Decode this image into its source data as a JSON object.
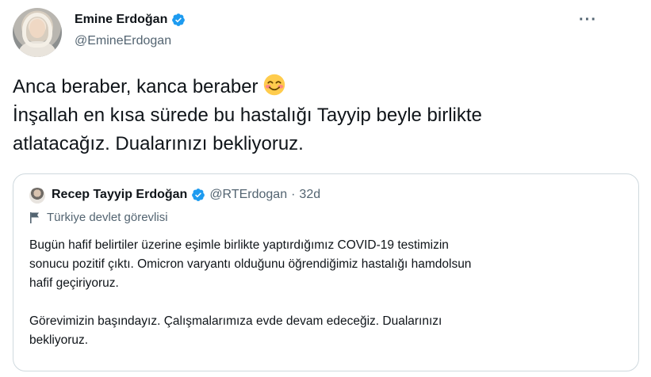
{
  "tweet": {
    "author": {
      "name": "Emine Erdoğan",
      "handle": "@EmineErdogan",
      "verified": true,
      "avatar_icon": "profile-photo"
    },
    "more_icon": "···",
    "text_lines": [
      "Anca beraber, kanca beraber",
      "İnşallah en kısa sürede bu hastalığı Tayyip beyle birlikte",
      "atlatacağız. Dualarınızı bekliyoruz."
    ],
    "emoji": "smiling-face-with-smiling-eyes"
  },
  "quote": {
    "author": {
      "name": "Recep Tayyip Erdoğan",
      "handle": "@RTErdogan",
      "separator": "·",
      "time": "32d",
      "verified": true
    },
    "label": {
      "icon": "flag-icon",
      "text": "Türkiye devlet görevlisi"
    },
    "lines": [
      "Bugün hafif belirtiler üzerine eşimle birlikte yaptırdığımız COVID-19 testimizin",
      "sonucu pozitif çıktı. Omicron varyantı olduğunu öğrendiğimiz hastalığı hamdolsun",
      "hafif geçiriyoruz.",
      "",
      "Görevimizin başındayız. Çalışmalarımıza evde devam edeceğiz. Dualarınızı",
      "bekliyoruz."
    ]
  },
  "colors": {
    "verified": "#1d9bf0",
    "secondary_text": "#536471",
    "border": "#cfd9de"
  }
}
